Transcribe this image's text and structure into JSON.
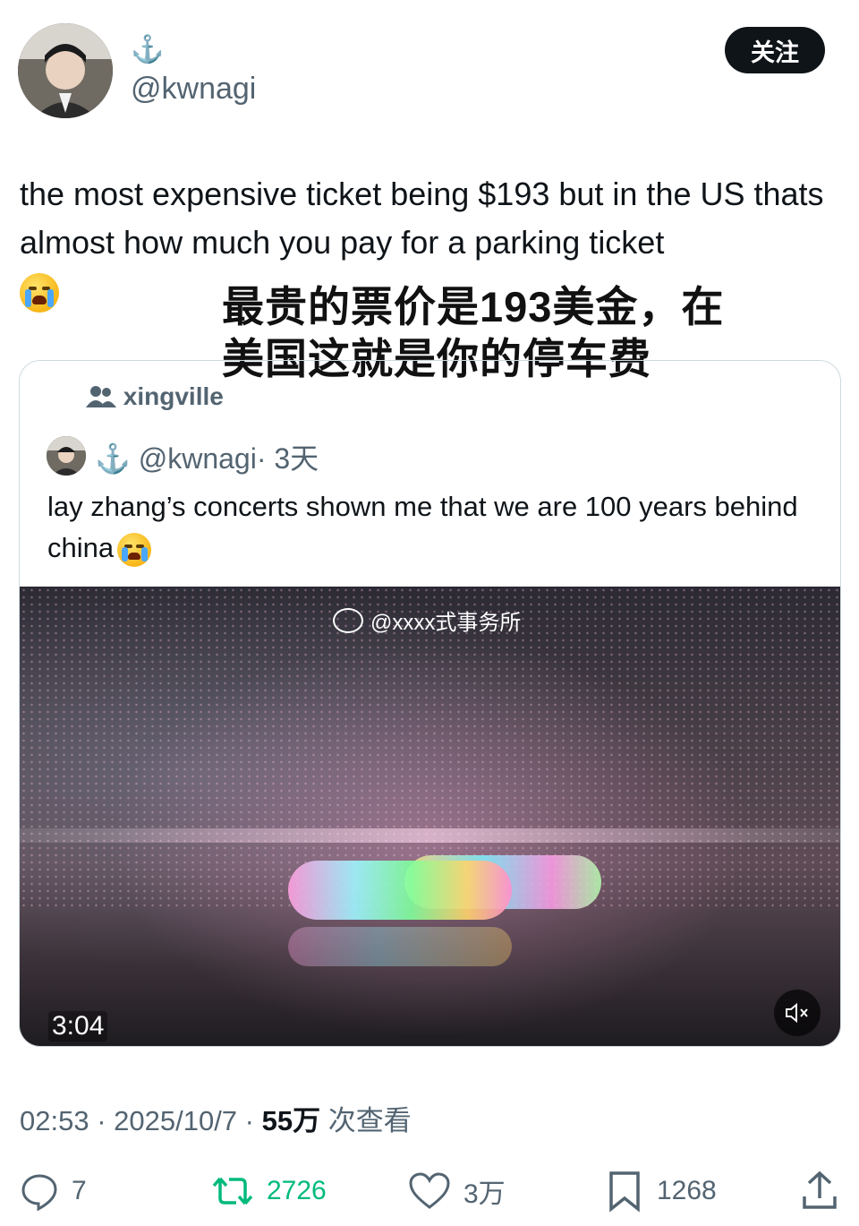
{
  "author": {
    "name_symbol": "⚓",
    "handle": "@kwnagi",
    "follow_label": "关注"
  },
  "tweet": {
    "text": "the most expensive ticket being $193 but in the US thats almost how much you pay for a parking ticket",
    "emoji": "loudly-crying-face"
  },
  "overlay_caption": {
    "line1": "最贵的票价是193美金，在",
    "line2": "美国这就是你的停车费"
  },
  "quoted": {
    "community": "xingville",
    "user_symbol": "⚓",
    "handle": "@kwnagi",
    "time": "· 3天",
    "text": "lay zhang’s concerts shown me that we are 100 years behind china",
    "video": {
      "watermark": "@xxxx式事务所",
      "duration": "3:04"
    }
  },
  "meta": {
    "time": "02:53",
    "date": "2025/10/7",
    "views": "55万",
    "views_label": "次查看"
  },
  "actions": {
    "replies": "7",
    "retweets": "2726",
    "likes": "3万",
    "bookmarks": "1268"
  },
  "colors": {
    "text": "#0f1419",
    "secondary": "#536471",
    "retweet": "#00ba7c",
    "border": "#cfd9de"
  }
}
